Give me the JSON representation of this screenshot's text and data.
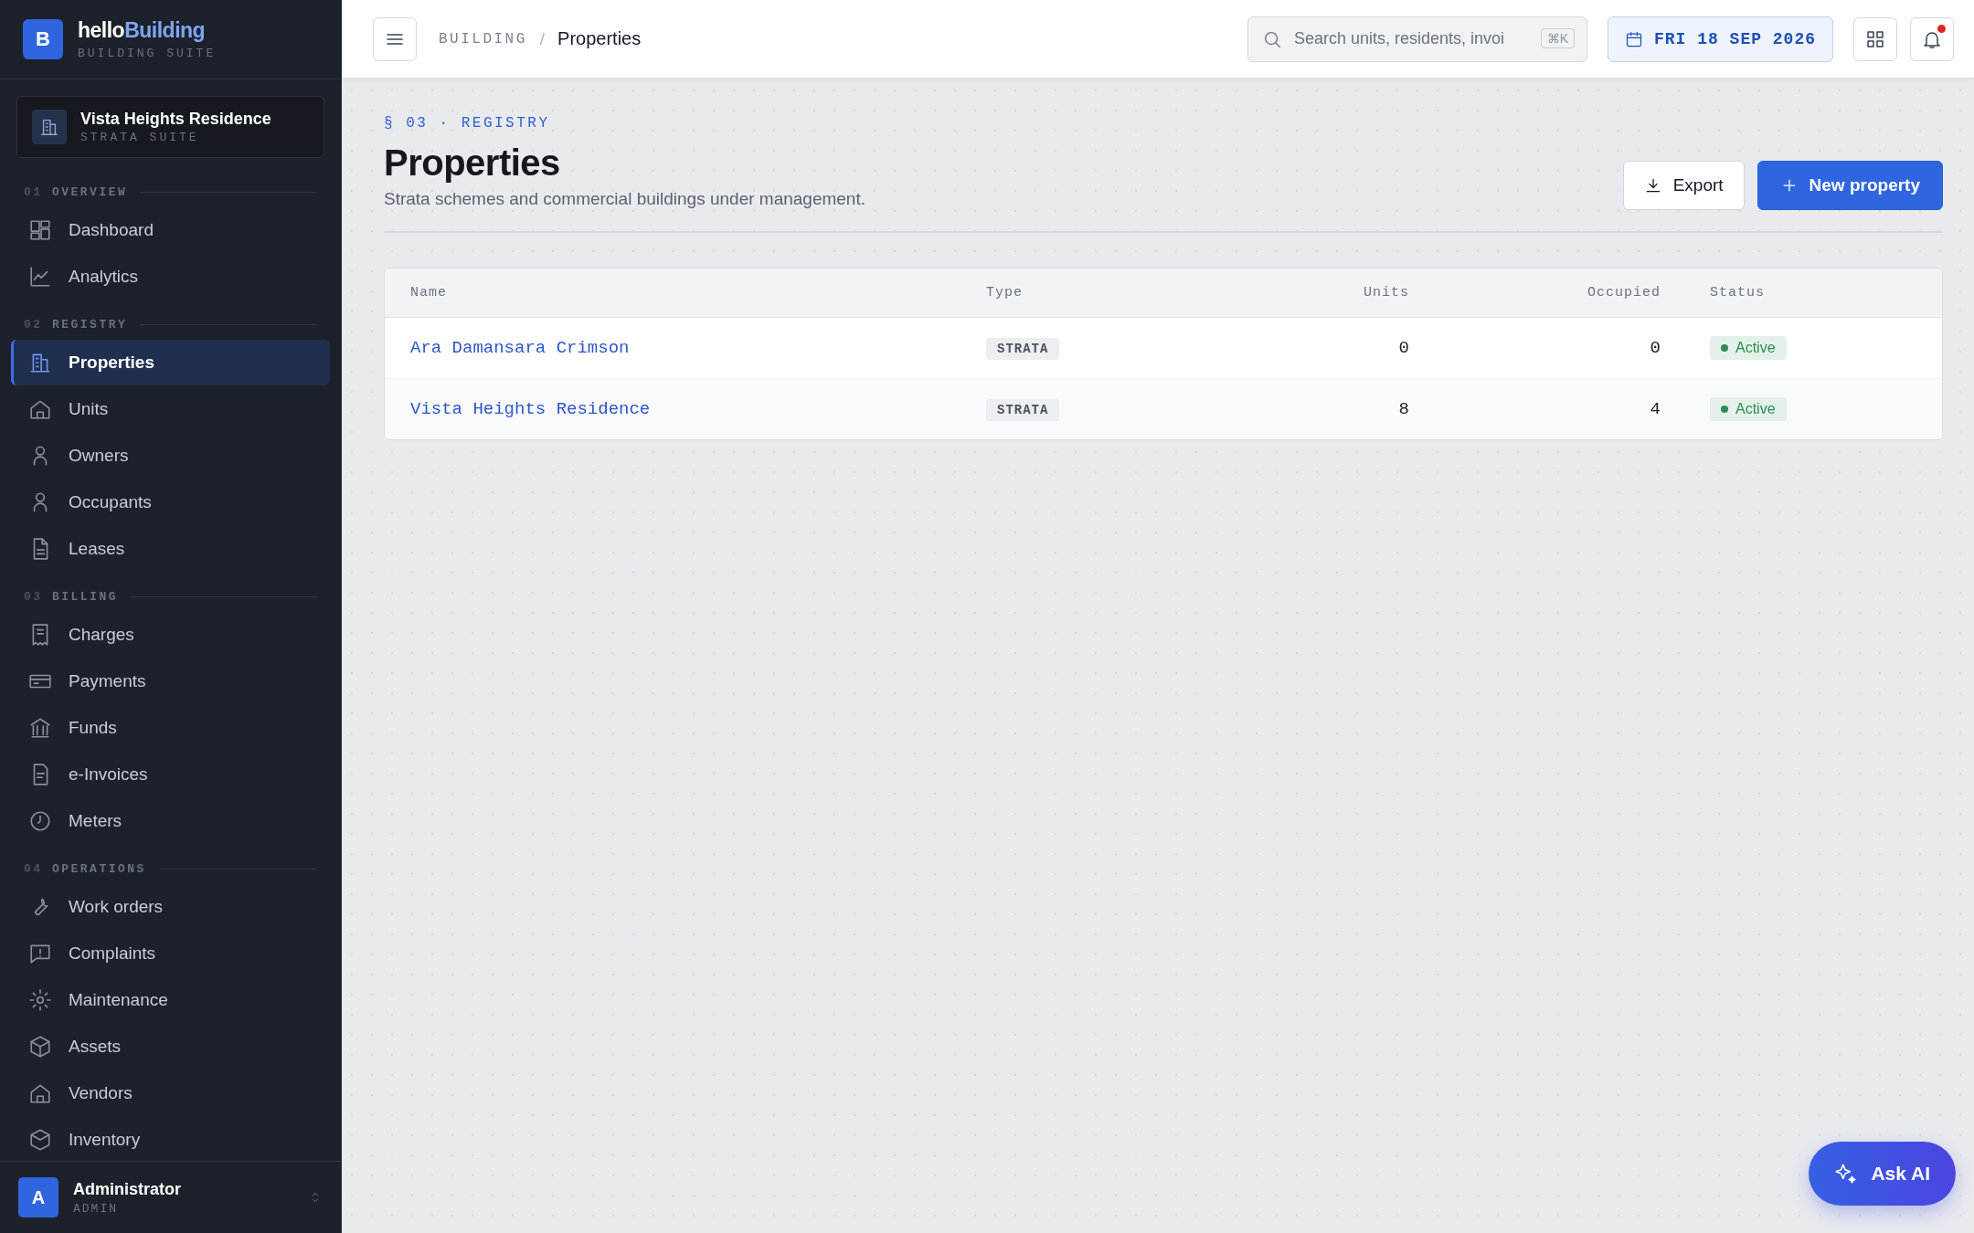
{
  "brand": {
    "logo_letter": "B",
    "name_lead": "hello",
    "name_accent": "Building",
    "tagline": "BUILDING SUITE"
  },
  "workspace": {
    "name": "Vista Heights Residence",
    "subtitle": "STRATA SUITE"
  },
  "sidebar": {
    "sections": [
      {
        "number": "01",
        "title": "OVERVIEW",
        "items": [
          {
            "label": "Dashboard",
            "selected": false
          },
          {
            "label": "Analytics",
            "selected": false
          }
        ]
      },
      {
        "number": "02",
        "title": "REGISTRY",
        "items": [
          {
            "label": "Properties",
            "selected": true
          },
          {
            "label": "Units",
            "selected": false
          },
          {
            "label": "Owners",
            "selected": false
          },
          {
            "label": "Occupants",
            "selected": false
          },
          {
            "label": "Leases",
            "selected": false
          }
        ]
      },
      {
        "number": "03",
        "title": "BILLING",
        "items": [
          {
            "label": "Charges",
            "selected": false
          },
          {
            "label": "Payments",
            "selected": false
          },
          {
            "label": "Funds",
            "selected": false
          },
          {
            "label": "e-Invoices",
            "selected": false
          },
          {
            "label": "Meters",
            "selected": false
          }
        ]
      },
      {
        "number": "04",
        "title": "OPERATIONS",
        "items": [
          {
            "label": "Work orders",
            "selected": false
          },
          {
            "label": "Complaints",
            "selected": false
          },
          {
            "label": "Maintenance",
            "selected": false
          },
          {
            "label": "Assets",
            "selected": false
          },
          {
            "label": "Vendors",
            "selected": false
          },
          {
            "label": "Inventory",
            "selected": false
          }
        ]
      }
    ]
  },
  "user": {
    "initial": "A",
    "name": "Administrator",
    "role": "ADMIN"
  },
  "topbar": {
    "breadcrumb": [
      "BUILDING",
      "Properties"
    ],
    "separator": "/",
    "search": {
      "placeholder": "Search units, residents, invoi",
      "shortcut": "⌘K"
    },
    "date": "FRI 18 SEP 2026",
    "notifications_unread": true
  },
  "page": {
    "eyebrow": "§ 03 · REGISTRY",
    "title": "Properties",
    "subtitle": "Strata schemes and commercial buildings under management.",
    "actions": [
      {
        "label": "Export",
        "kind": "secondary"
      },
      {
        "label": "New property",
        "kind": "primary"
      }
    ]
  },
  "table": {
    "columns": [
      "Name",
      "Type",
      "Units",
      "Occupied",
      "Status"
    ],
    "rows": [
      {
        "name": "Ara Damansara Crimson",
        "type": "STRATA",
        "units": "0",
        "occupied": "0",
        "status": {
          "label": "Active",
          "color": "#2e8b57"
        }
      },
      {
        "name": "Vista Heights Residence",
        "type": "STRATA",
        "units": "8",
        "occupied": "4",
        "status": {
          "label": "Active",
          "color": "#2e8b57"
        }
      }
    ]
  },
  "assistant": {
    "label": "Ask AI"
  }
}
